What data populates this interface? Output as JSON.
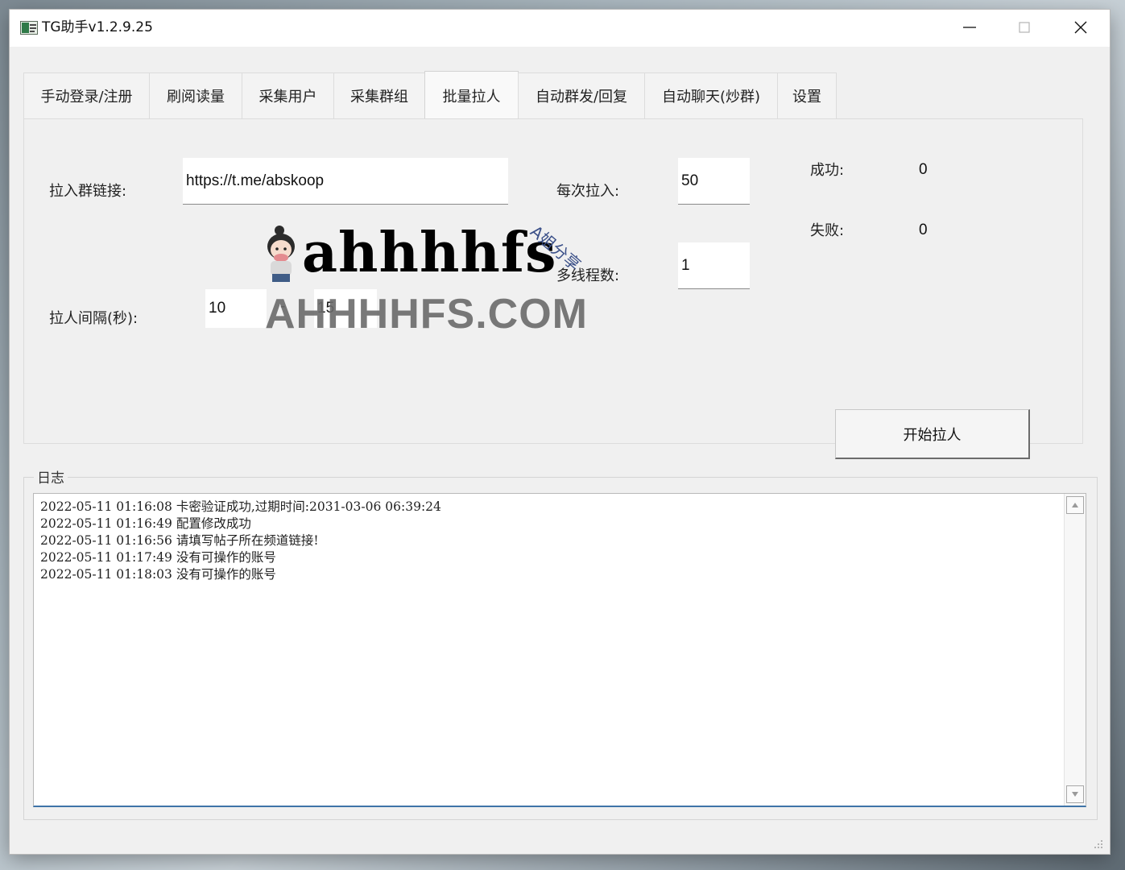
{
  "window": {
    "title": "TG助手v1.2.9.25"
  },
  "tabs": [
    {
      "label": "手动登录/注册"
    },
    {
      "label": "刷阅读量"
    },
    {
      "label": "采集用户"
    },
    {
      "label": "采集群组"
    },
    {
      "label": "批量拉人",
      "active": true
    },
    {
      "label": "自动群发/回复"
    },
    {
      "label": "自动聊天(炒群)"
    },
    {
      "label": "设置"
    }
  ],
  "form": {
    "group_link_label": "拉入群链接:",
    "group_link_value": "https://t.me/abskoop",
    "per_pull_label": "每次拉入:",
    "per_pull_value": "50",
    "threads_label": "多线程数:",
    "threads_value": "1",
    "interval_label": "拉人间隔(秒):",
    "interval_min": "10",
    "interval_sep": "-",
    "interval_max": "15",
    "success_label": "成功:",
    "success_value": "0",
    "fail_label": "失败:",
    "fail_value": "0",
    "start_button": "开始拉人"
  },
  "watermark": {
    "logo_text": "ahhhhfs",
    "tag_text": "A姐分享",
    "domain": "AHHHHFS.COM"
  },
  "log": {
    "title": "日志",
    "lines": [
      "2022-05-11 01:16:08 卡密验证成功,过期时间:2031-03-06 06:39:24",
      "2022-05-11 01:16:49 配置修改成功",
      "2022-05-11 01:16:56 请填写帖子所在频道链接!",
      "2022-05-11 01:17:49 没有可操作的账号",
      "2022-05-11 01:18:03 没有可操作的账号"
    ]
  }
}
